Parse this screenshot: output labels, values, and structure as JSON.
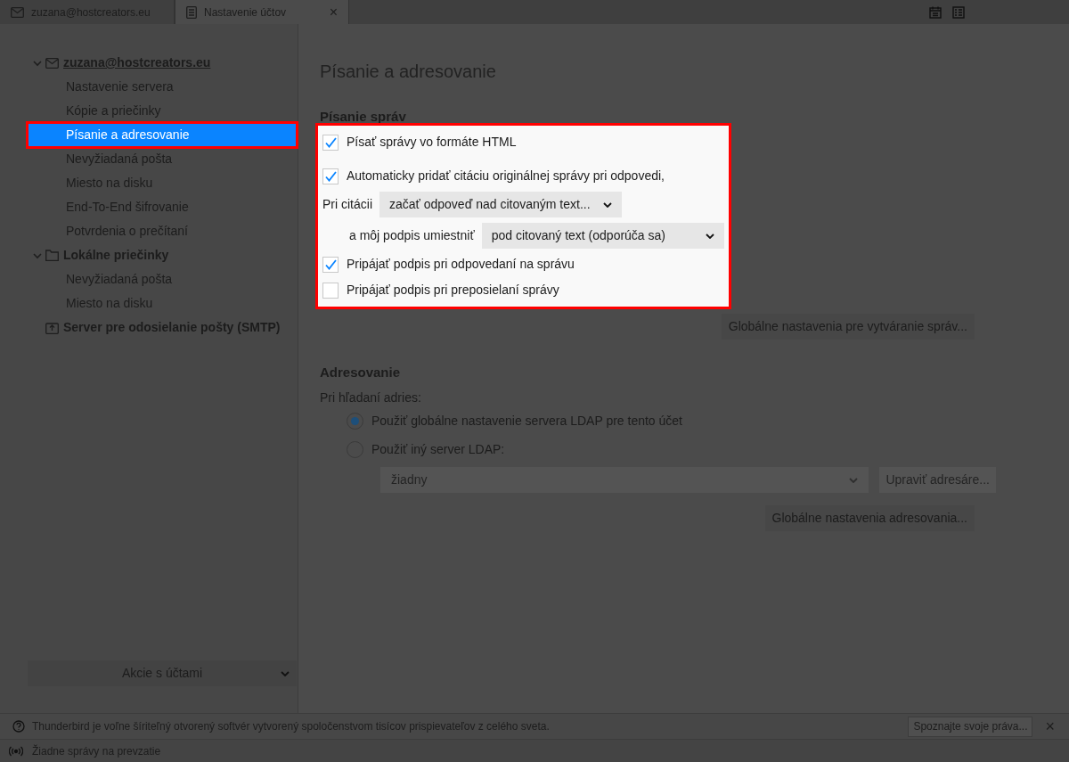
{
  "tabs": [
    {
      "label": "zuzana@hostcreators.eu",
      "kind": "mail",
      "selected": false
    },
    {
      "label": "Nastavenie účtov",
      "kind": "doc",
      "selected": true,
      "close": "×"
    }
  ],
  "sidebar": {
    "accounts": [
      {
        "label": "zuzana@hostcreators.eu",
        "kind": "mail",
        "expanded": true,
        "children": [
          {
            "label": "Nastavenie servera",
            "selected": false
          },
          {
            "label": "Kópie a priečinky",
            "selected": false
          },
          {
            "label": "Písanie a adresovanie",
            "selected": true
          },
          {
            "label": "Nevyžiadaná pošta",
            "selected": false
          },
          {
            "label": "Miesto na disku",
            "selected": false
          },
          {
            "label": "End-To-End šifrovanie",
            "selected": false
          },
          {
            "label": "Potvrdenia o prečítaní",
            "selected": false
          }
        ]
      },
      {
        "label": "Lokálne priečinky",
        "kind": "folder",
        "expanded": true,
        "children": [
          {
            "label": "Nevyžiadaná pošta",
            "selected": false
          },
          {
            "label": "Miesto na disku",
            "selected": false
          }
        ]
      },
      {
        "label": "Server pre odosielanie pošty (SMTP)",
        "kind": "smtp"
      }
    ],
    "footer_button": "Akcie s účtami"
  },
  "content": {
    "title": "Písanie a adresovanie",
    "composing": {
      "heading": "Písanie správ",
      "highlighted": true,
      "options": [
        {
          "kind": "checkbox",
          "label": "Písať správy vo formáte HTML",
          "checked": true
        },
        {
          "kind": "checkbox",
          "label": "Automaticky pridať citáciu originálnej správy pri odpovedi,",
          "checked": true
        },
        {
          "kind": "select",
          "label": "Pri citácii",
          "value": "začať odpoveď nad citovaným text...",
          "indented": false
        },
        {
          "kind": "select",
          "label": "a môj podpis umiestniť",
          "value": "pod citovaný text (odporúča sa)",
          "indented": true
        },
        {
          "kind": "checkbox",
          "label": "Pripájať podpis pri odpovedaní na správu",
          "checked": true
        },
        {
          "kind": "checkbox",
          "label": "Pripájať podpis pri preposielaní správy",
          "checked": false
        }
      ],
      "button": "Globálne nastavenia pre vytváranie správ..."
    },
    "addressing": {
      "heading": "Adresovanie",
      "label": "Pri hľadaní adries:",
      "radios": [
        {
          "label": "Použiť globálne nastavenie servera LDAP pre tento účet",
          "selected": true
        },
        {
          "label": "Použiť iný server LDAP:",
          "selected": false
        }
      ],
      "select": {
        "value": "žiadny",
        "disabled": true
      },
      "edit_button": {
        "label": "Upraviť adresáre...",
        "disabled": true
      },
      "button": "Globálne nastavenia adresovania..."
    }
  },
  "notification": {
    "text": "Thunderbird je voľne šíriteľný otvorený softvér vytvorený spoločenstvom tisícov prispievateľov z celého sveta.",
    "button": "Spoznajte svoje práva...",
    "close": "×"
  },
  "status_bar": {
    "text": "Žiadne správy na prevzatie"
  }
}
